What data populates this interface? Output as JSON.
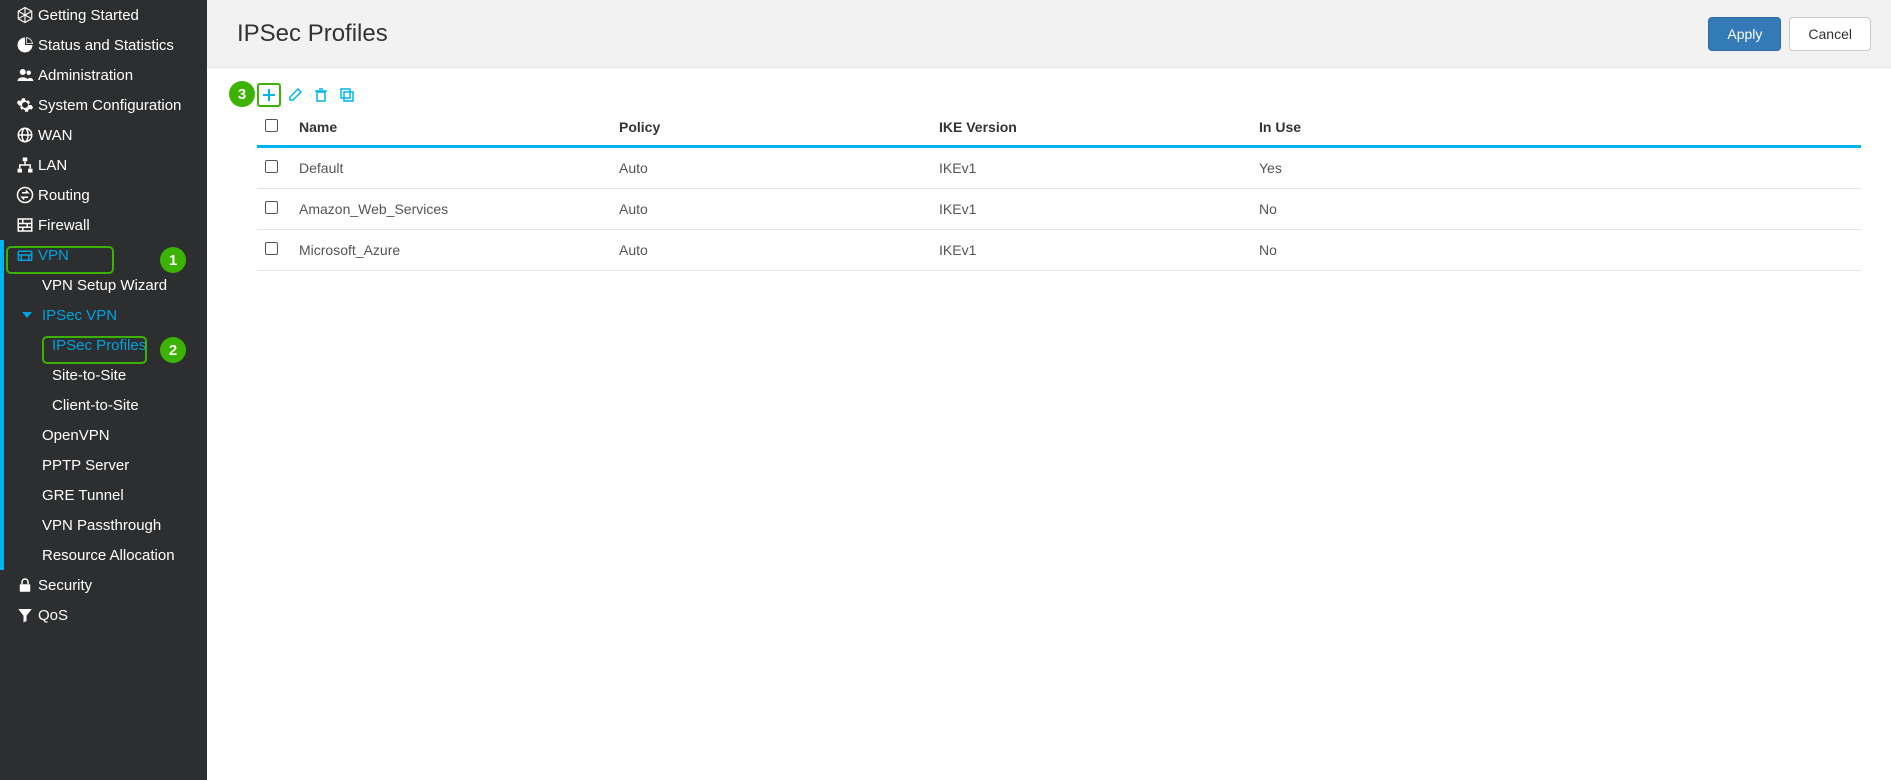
{
  "page": {
    "title": "IPSec Profiles",
    "apply_label": "Apply",
    "cancel_label": "Cancel"
  },
  "annotations": {
    "badge1": "1",
    "badge2": "2",
    "badge3": "3"
  },
  "sidebar": {
    "items": [
      {
        "label": "Getting Started"
      },
      {
        "label": "Status and Statistics"
      },
      {
        "label": "Administration"
      },
      {
        "label": "System Configuration"
      },
      {
        "label": "WAN"
      },
      {
        "label": "LAN"
      },
      {
        "label": "Routing"
      },
      {
        "label": "Firewall"
      },
      {
        "label": "VPN"
      },
      {
        "label": "Security"
      },
      {
        "label": "QoS"
      }
    ],
    "vpn_sub": [
      {
        "label": "VPN Setup Wizard"
      },
      {
        "label": "IPSec VPN"
      },
      {
        "label": "OpenVPN"
      },
      {
        "label": "PPTP Server"
      },
      {
        "label": "GRE Tunnel"
      },
      {
        "label": "VPN Passthrough"
      },
      {
        "label": "Resource Allocation"
      }
    ],
    "ipsec_sub": [
      {
        "label": "IPSec Profiles"
      },
      {
        "label": "Site-to-Site"
      },
      {
        "label": "Client-to-Site"
      }
    ]
  },
  "toolbar_icons": {
    "add": "add-icon",
    "edit": "edit-icon",
    "delete": "delete-icon",
    "copy": "copy-icon"
  },
  "table": {
    "headers": {
      "name": "Name",
      "policy": "Policy",
      "ike": "IKE Version",
      "inuse": "In Use"
    },
    "rows": [
      {
        "name": "Default",
        "policy": "Auto",
        "ike": "IKEv1",
        "inuse": "Yes"
      },
      {
        "name": "Amazon_Web_Services",
        "policy": "Auto",
        "ike": "IKEv1",
        "inuse": "No"
      },
      {
        "name": "Microsoft_Azure",
        "policy": "Auto",
        "ike": "IKEv1",
        "inuse": "No"
      }
    ]
  }
}
